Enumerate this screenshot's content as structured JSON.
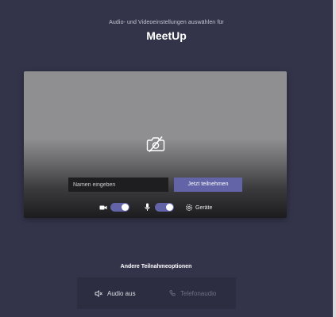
{
  "header": {
    "subtitle": "Audio- und Videoeinstellungen auswählen für",
    "title": "MeetUp"
  },
  "preview": {
    "camera_state_icon": "camera-off-icon",
    "name_input": {
      "placeholder": "Namen eingeben",
      "value": ""
    },
    "join_label": "Jetzt teilnehmen",
    "controls": {
      "camera_icon": "video-camera-icon",
      "camera_on": true,
      "mic_icon": "microphone-icon",
      "mic_on": true,
      "devices_icon": "gear-icon",
      "devices_label": "Geräte"
    }
  },
  "other_options": {
    "label": "Andere Teilnahmeoptionen",
    "audio_off": {
      "icon": "speaker-off-icon",
      "label": "Audio aus"
    },
    "phone_audio": {
      "icon": "phone-icon",
      "label": "Telefonaudio",
      "enabled": false
    }
  },
  "colors": {
    "background": "#33344a",
    "accent": "#6264a7",
    "input_bg": "#1e1e20"
  }
}
